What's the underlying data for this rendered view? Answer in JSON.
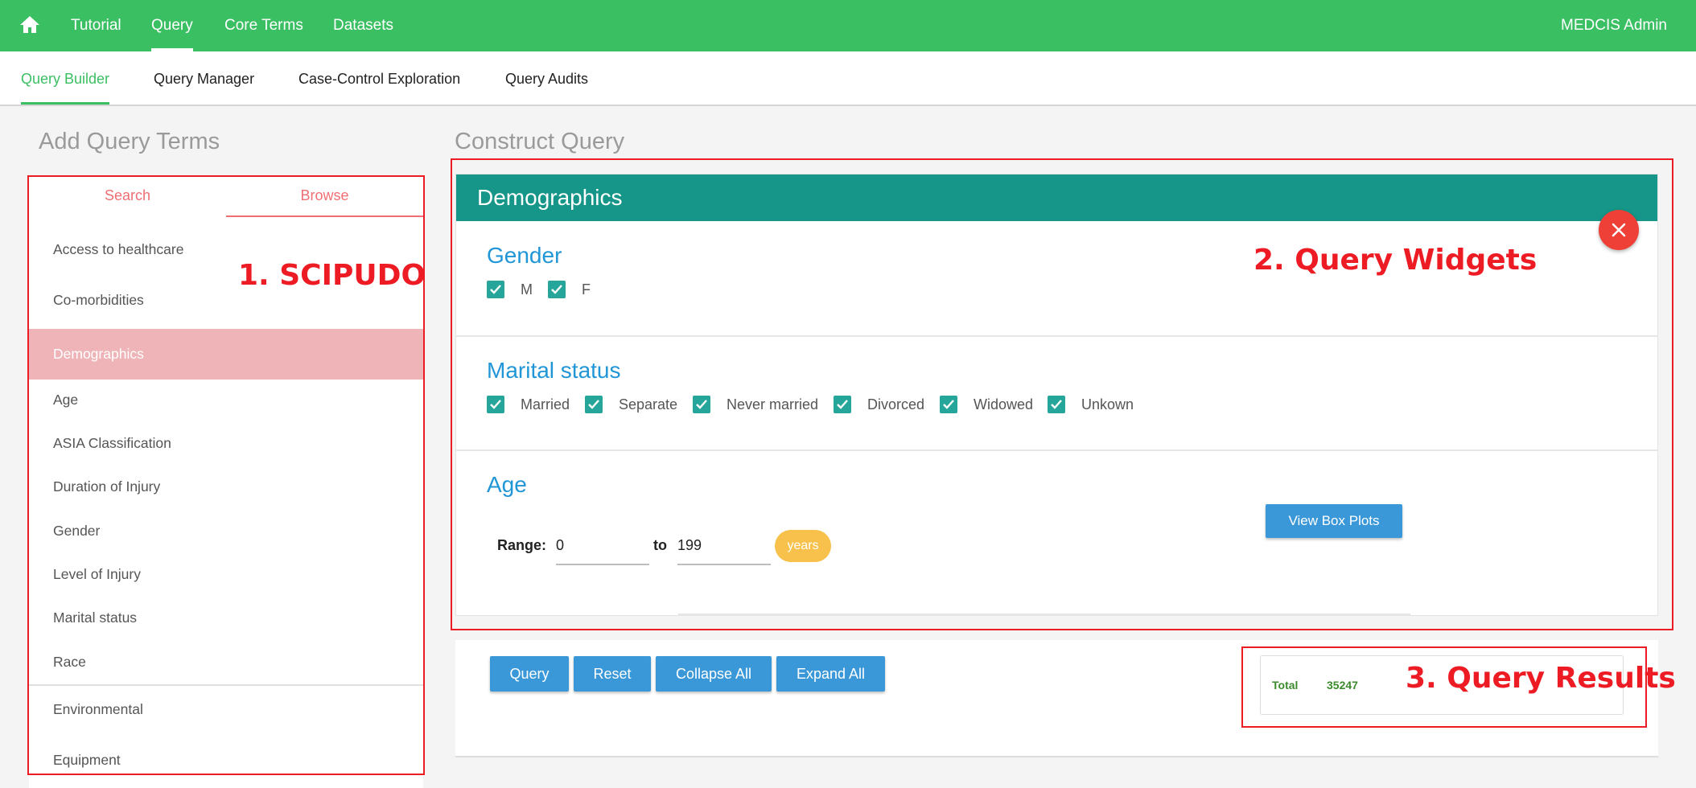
{
  "top_nav": {
    "items": [
      {
        "label": "Tutorial"
      },
      {
        "label": "Query"
      },
      {
        "label": "Core Terms"
      },
      {
        "label": "Datasets"
      }
    ],
    "active_index": 1,
    "user": "MEDCIS Admin",
    "colors": {
      "bar": "#3bbf63"
    }
  },
  "sub_nav": {
    "items": [
      {
        "label": "Query Builder"
      },
      {
        "label": "Query Manager"
      },
      {
        "label": "Case-Control Exploration"
      },
      {
        "label": "Query Audits"
      }
    ],
    "active_index": 0
  },
  "left": {
    "title": "Add Query Terms",
    "tabs": [
      {
        "label": "Search"
      },
      {
        "label": "Browse"
      }
    ],
    "active_tab": 1,
    "categories": [
      {
        "label": "Access to healthcare"
      },
      {
        "label": "Co-morbidities"
      },
      {
        "label": "Demographics",
        "selected": true
      },
      {
        "label": "Age"
      },
      {
        "label": "ASIA Classification"
      },
      {
        "label": "Duration of Injury"
      },
      {
        "label": "Gender"
      },
      {
        "label": "Level of Injury"
      },
      {
        "label": "Marital status"
      },
      {
        "label": "Race"
      },
      {
        "label": "Environmental"
      },
      {
        "label": "Equipment"
      }
    ]
  },
  "construct": {
    "title": "Construct Query",
    "card_title": "Demographics",
    "close_icon": "close-icon",
    "gender": {
      "title": "Gender",
      "options": [
        {
          "label": "M",
          "checked": true
        },
        {
          "label": "F",
          "checked": true
        }
      ]
    },
    "marital": {
      "title": "Marital status",
      "options": [
        {
          "label": "Married",
          "checked": true
        },
        {
          "label": "Separate",
          "checked": true
        },
        {
          "label": "Never married",
          "checked": true
        },
        {
          "label": "Divorced",
          "checked": true
        },
        {
          "label": "Widowed",
          "checked": true
        },
        {
          "label": "Unkown",
          "checked": true
        }
      ]
    },
    "age": {
      "title": "Age",
      "range_label": "Range:",
      "from": "0",
      "to_label": "to",
      "to": "199",
      "unit": "years",
      "box_plots_label": "View Box Plots"
    }
  },
  "actions": {
    "query": "Query",
    "reset": "Reset",
    "collapse_all": "Collapse All",
    "expand_all": "Expand All"
  },
  "results": {
    "total_label": "Total",
    "total_value": "35247"
  },
  "annotations": {
    "scipudo": "1. SCIPUDO",
    "widgets": "2. Query Widgets",
    "results": "3. Query Results"
  }
}
